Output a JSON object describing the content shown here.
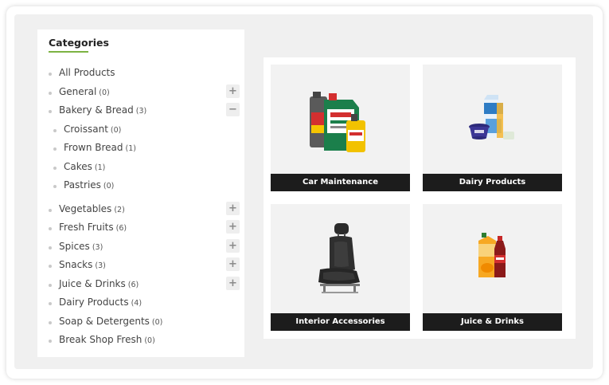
{
  "sidebar": {
    "title": "Categories",
    "items": [
      {
        "label": "All Products",
        "count": "",
        "toggle": "",
        "level": 0
      },
      {
        "label": "General",
        "count": "(0)",
        "toggle": "+",
        "level": 0
      },
      {
        "label": "Bakery & Bread",
        "count": "(3)",
        "toggle": "−",
        "level": 0
      },
      {
        "label": "Croissant",
        "count": "(0)",
        "toggle": "",
        "level": 1
      },
      {
        "label": "Frown Bread",
        "count": "(1)",
        "toggle": "",
        "level": 1
      },
      {
        "label": "Cakes",
        "count": "(1)",
        "toggle": "",
        "level": 1
      },
      {
        "label": "Pastries",
        "count": "(0)",
        "toggle": "",
        "level": 1
      },
      {
        "label": "Vegetables",
        "count": "(2)",
        "toggle": "+",
        "level": 0
      },
      {
        "label": "Fresh Fruits",
        "count": "(6)",
        "toggle": "+",
        "level": 0
      },
      {
        "label": "Spices",
        "count": "(3)",
        "toggle": "+",
        "level": 0
      },
      {
        "label": "Snacks",
        "count": "(3)",
        "toggle": "+",
        "level": 0
      },
      {
        "label": "Juice & Drinks",
        "count": "(6)",
        "toggle": "+",
        "level": 0
      },
      {
        "label": "Dairy Products",
        "count": "(4)",
        "toggle": "",
        "level": 0
      },
      {
        "label": "Soap & Detergents",
        "count": "(0)",
        "toggle": "",
        "level": 0
      },
      {
        "label": "Break Shop Fresh",
        "count": "(0)",
        "toggle": "",
        "level": 0
      }
    ]
  },
  "cards": [
    {
      "label": "Car Maintenance",
      "icon": "motor-oil-icon"
    },
    {
      "label": "Dairy Products",
      "icon": "milk-carton-icon"
    },
    {
      "label": "Interior Accessories",
      "icon": "car-seat-icon"
    },
    {
      "label": "Juice & Drinks",
      "icon": "juice-bottle-icon"
    }
  ],
  "colors": {
    "accent": "#7cb342",
    "label_bar": "#1c1c1c",
    "panel_bg": "#f0f0f0"
  }
}
